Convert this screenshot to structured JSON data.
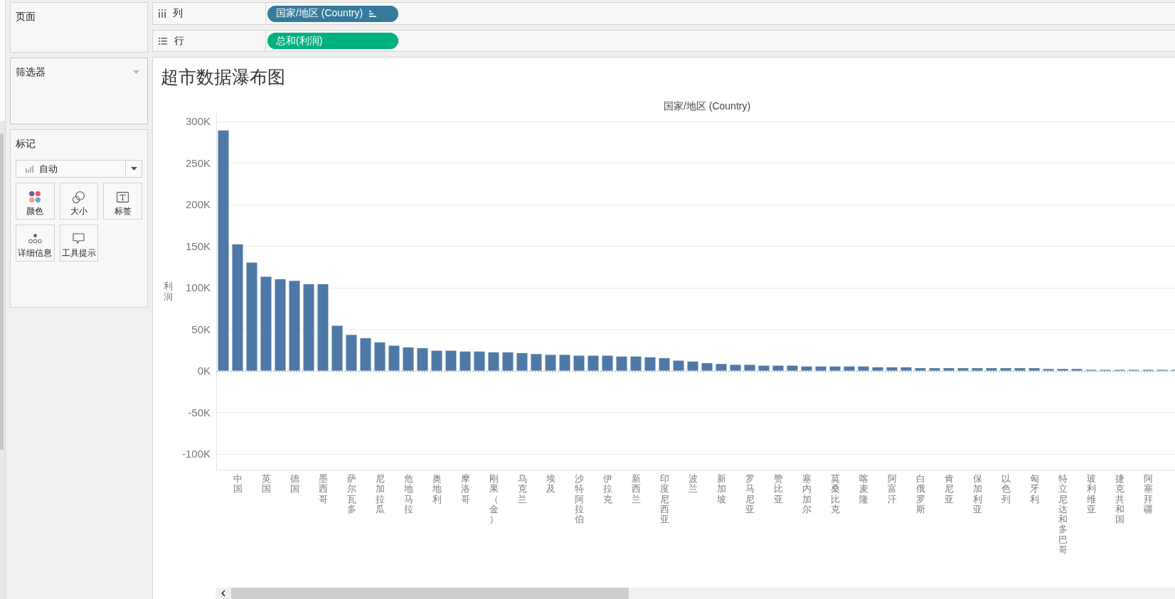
{
  "left_panel": {
    "pages": {
      "title": "页面"
    },
    "filters": {
      "title": "筛选器"
    },
    "marks": {
      "title": "标记",
      "mark_type": "自动",
      "buttons": [
        {
          "kind": "color",
          "label": "颜色"
        },
        {
          "kind": "size",
          "label": "大小"
        },
        {
          "kind": "label",
          "label": "标签"
        },
        {
          "kind": "detail",
          "label": "详细信息"
        },
        {
          "kind": "tooltip",
          "label": "工具提示"
        }
      ]
    }
  },
  "shelves": [
    {
      "kind": "columns",
      "label": "列",
      "pill": {
        "text": "国家/地区 (Country)",
        "color": "#367b9b",
        "sorted": true
      }
    },
    {
      "kind": "rows",
      "label": "行",
      "pill": {
        "text": "总和(利润)",
        "color": "#00b180",
        "sorted": false
      }
    }
  ],
  "worksheet": {
    "title": "超市数据瀑布图",
    "chart_data": {
      "type": "bar",
      "xlabel": "国家/地区 (Country)",
      "ylabel": "利润",
      "categories": [
        null,
        "中国",
        null,
        "英国",
        null,
        "德国",
        null,
        "墨西哥",
        null,
        "萨尔瓦多",
        null,
        "尼加拉瓜",
        null,
        "危地马拉",
        null,
        "奥地利",
        null,
        "摩洛哥",
        null,
        "刚果（金）",
        null,
        "乌克兰",
        null,
        "埃及",
        null,
        "沙特阿拉伯",
        null,
        "伊拉克",
        null,
        "新西兰",
        null,
        "印度尼西亚",
        null,
        "波兰",
        null,
        "新加坡",
        null,
        "罗马尼亚",
        null,
        "赞比亚",
        null,
        "塞内加尔",
        null,
        "莫桑比克",
        null,
        "喀麦隆",
        null,
        "阿富汗",
        null,
        "白俄罗斯",
        null,
        "肯尼亚",
        null,
        "保加利亚",
        null,
        "以色列",
        null,
        "匈牙利",
        null,
        "特立尼达和多巴哥",
        null,
        "玻利维亚",
        null,
        "捷克共和国",
        null,
        "阿塞拜疆",
        null,
        null
      ],
      "series": [
        {
          "color": "#4e79a7",
          "values": [
            289000,
            152000,
            130000,
            113000,
            110000,
            108000,
            104000,
            104000,
            54000,
            43000,
            39000,
            34000,
            30000,
            28000,
            27000,
            24000,
            24000,
            23000,
            23000,
            22000,
            22000,
            21000,
            20000,
            19000,
            19000,
            18000,
            18000,
            18000,
            17000,
            17000,
            16000,
            15000,
            12000,
            11000,
            9000,
            8000,
            7000,
            7000,
            6000,
            6000,
            6000,
            5000,
            5000,
            5000,
            5000,
            5000,
            4000,
            4000,
            4000,
            3000,
            3000,
            3000,
            3000,
            3000,
            3000,
            3000,
            3000,
            3000,
            2000,
            2000,
            2000,
            1000,
            1000,
            1000,
            1000,
            1000,
            1000,
            1000
          ]
        }
      ],
      "ylim": [
        -120000,
        310000
      ],
      "yticks": [
        {
          "value": 300000,
          "label": "300K"
        },
        {
          "value": 250000,
          "label": "250K"
        },
        {
          "value": 200000,
          "label": "200K"
        },
        {
          "value": 150000,
          "label": "150K"
        },
        {
          "value": 100000,
          "label": "100K"
        },
        {
          "value": 50000,
          "label": "50K"
        },
        {
          "value": 0,
          "label": "0K"
        },
        {
          "value": -50000,
          "label": "-50K"
        },
        {
          "value": -100000,
          "label": "-100K"
        }
      ],
      "grid": true,
      "ref_lines": [
        {
          "axis": "y",
          "value": 0
        }
      ]
    }
  }
}
